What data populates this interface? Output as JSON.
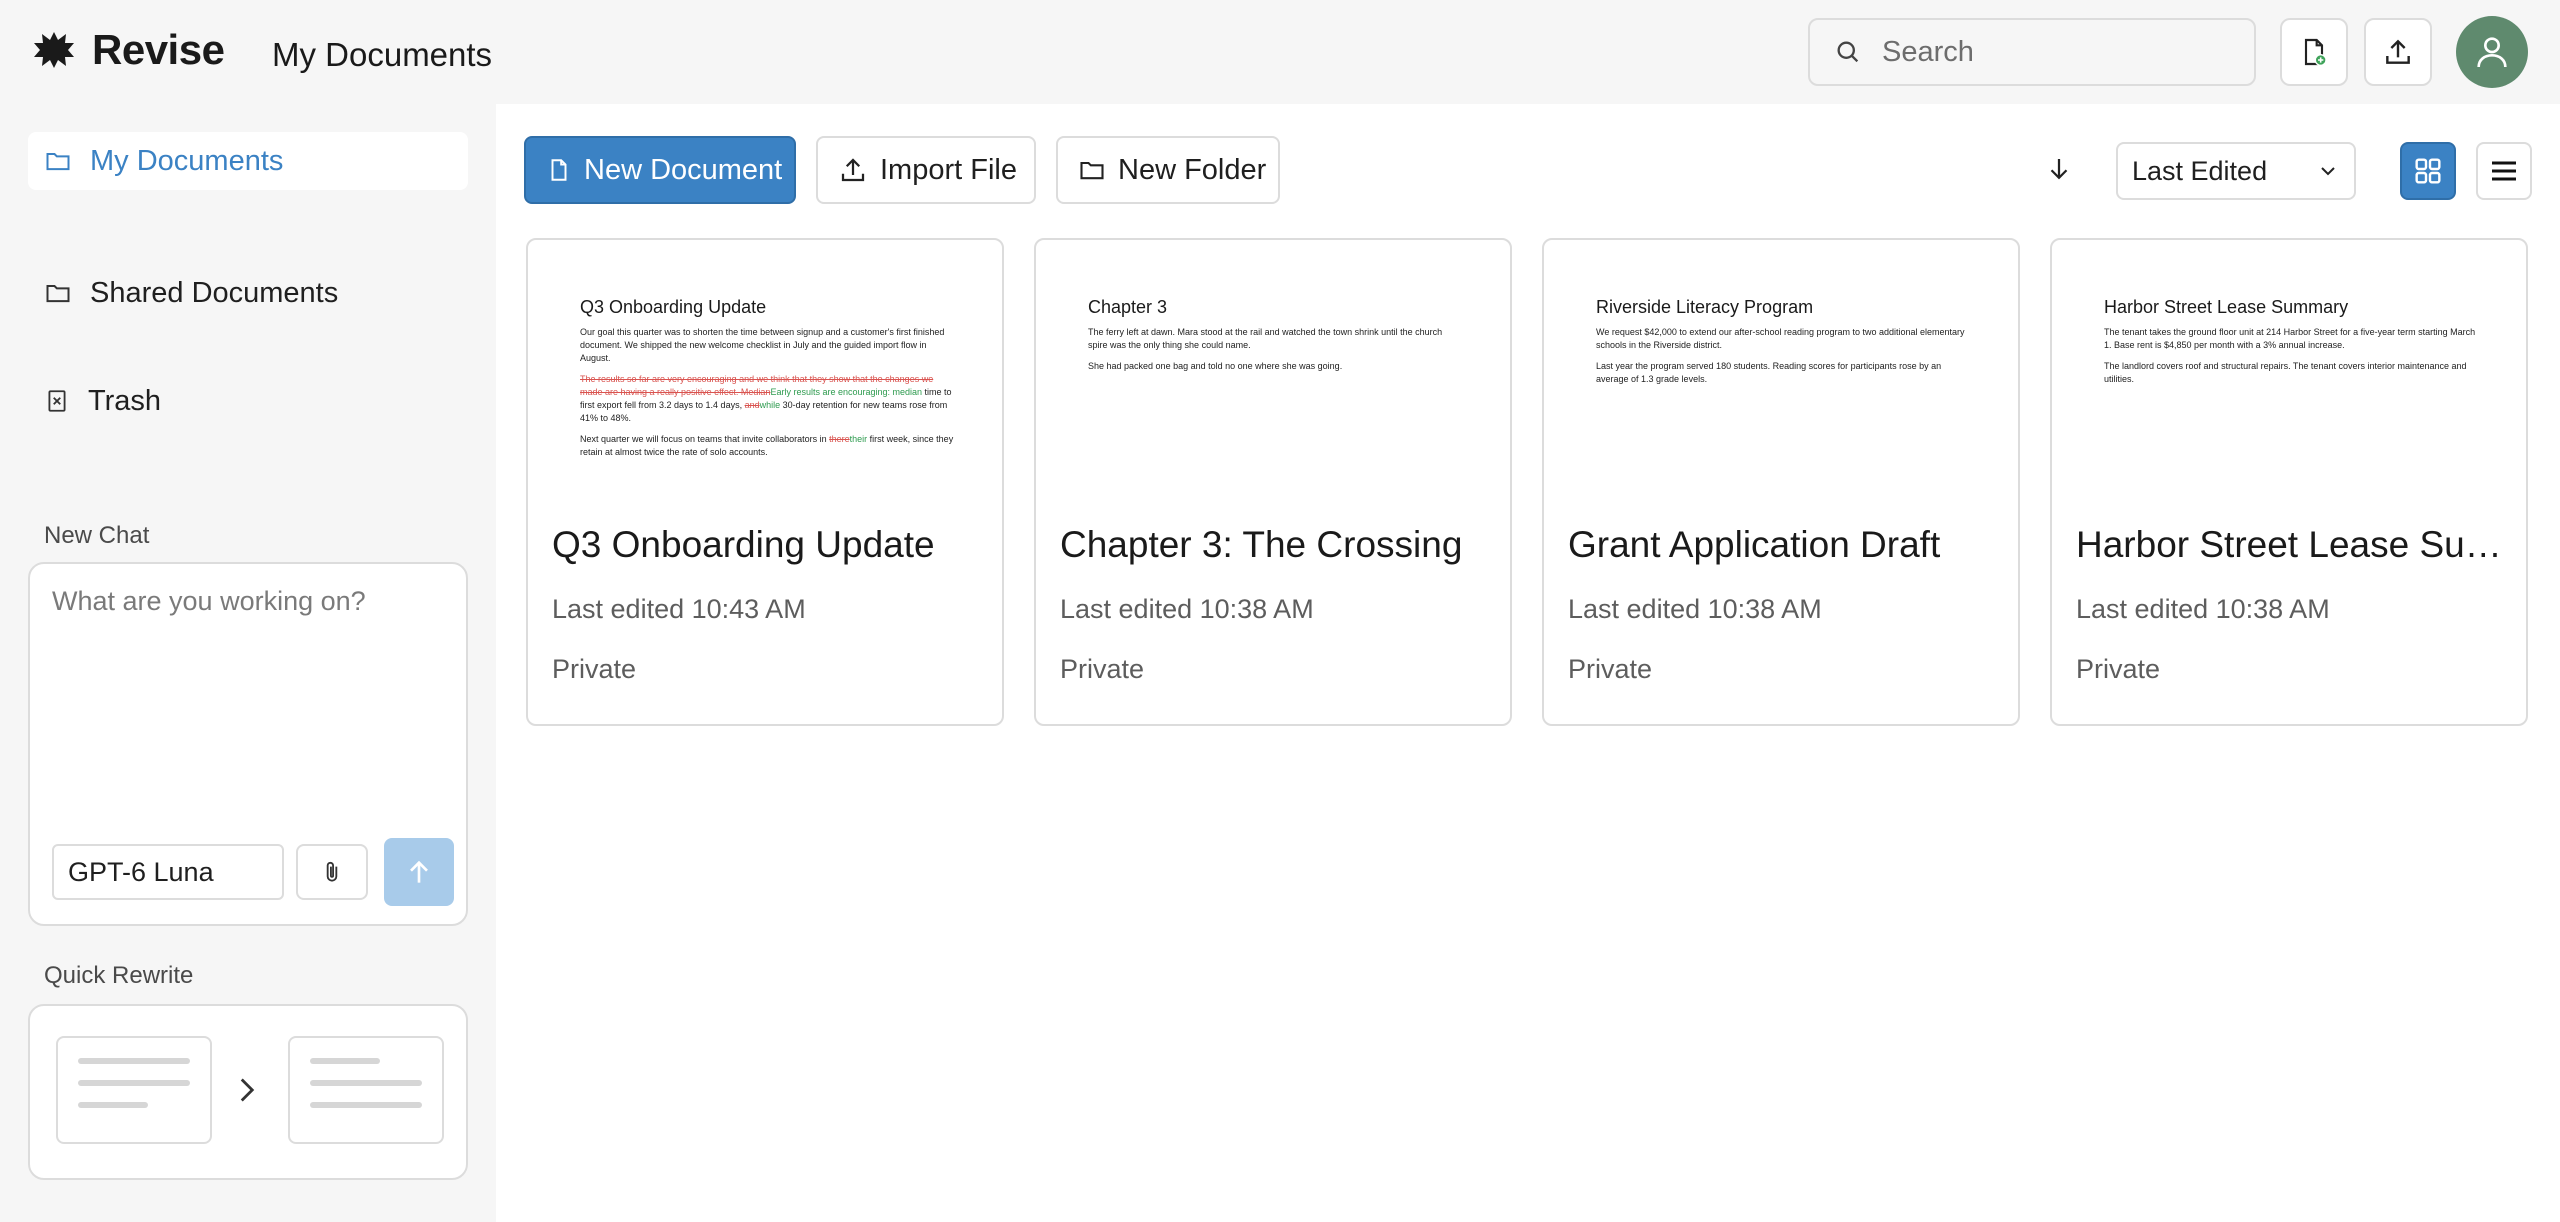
{
  "app": {
    "name": "Revise",
    "page_title": "My Documents"
  },
  "search": {
    "placeholder": "Search"
  },
  "sidebar": {
    "items": [
      {
        "label": "My Documents"
      },
      {
        "label": "Shared Documents"
      },
      {
        "label": "Trash"
      }
    ],
    "new_chat_label": "New Chat",
    "chat_placeholder": "What are you working on?",
    "model": "GPT-6 Luna",
    "quick_rewrite_label": "Quick Rewrite"
  },
  "toolbar": {
    "new_document": "New Document",
    "import_file": "Import File",
    "new_folder": "New Folder",
    "sort_value": "Last Edited"
  },
  "documents": [
    {
      "title": "Q3 Onboarding Update",
      "edited": "Last edited 10:43 AM",
      "privacy": "Private",
      "preview_title": "Q3 Onboarding Update",
      "p1": "Our goal this quarter was to shorten the time between signup and a customer's first finished document. We shipped the new welcome checklist in July and the guided import flow in August.",
      "p2_del": "The results so far are very encouraging and we think that they show that the changes we made are having a really positive effect. Median",
      "p2_ins": "Early results are encouraging: median",
      "p2_rest": " time to first export fell from 3.2 days to 1.4 days, ",
      "p2_del2": "and",
      "p2_ins2": "while",
      "p2_rest2": " 30-day retention for new teams rose from 41% to 48%.",
      "p3_a": "Next quarter we will focus on teams that invite collaborators in ",
      "p3_del": "there",
      "p3_ins": "their",
      "p3_b": " first week, since they retain at almost twice the rate of solo accounts."
    },
    {
      "title": "Chapter 3: The Crossing",
      "edited": "Last edited 10:38 AM",
      "privacy": "Private",
      "preview_title": "Chapter 3",
      "p1": "The ferry left at dawn. Mara stood at the rail and watched the town shrink until the church spire was the only thing she could name.",
      "p2": "She had packed one bag and told no one where she was going."
    },
    {
      "title": "Grant Application Draft",
      "edited": "Last edited 10:38 AM",
      "privacy": "Private",
      "preview_title": "Riverside Literacy Program",
      "p1": "We request $42,000 to extend our after-school reading program to two additional elementary schools in the Riverside district.",
      "p2": "Last year the program served 180 students. Reading scores for participants rose by an average of 1.3 grade levels."
    },
    {
      "title": "Harbor Street Lease Summary",
      "edited": "Last edited 10:38 AM",
      "privacy": "Private",
      "preview_title": "Harbor Street Lease Summary",
      "p1": "The tenant takes the ground floor unit at 214 Harbor Street for a five-year term starting March 1. Base rent is $4,850 per month with a 3% annual increase.",
      "p2": "The landlord covers roof and structural repairs. The tenant covers interior maintenance and utilities."
    }
  ]
}
